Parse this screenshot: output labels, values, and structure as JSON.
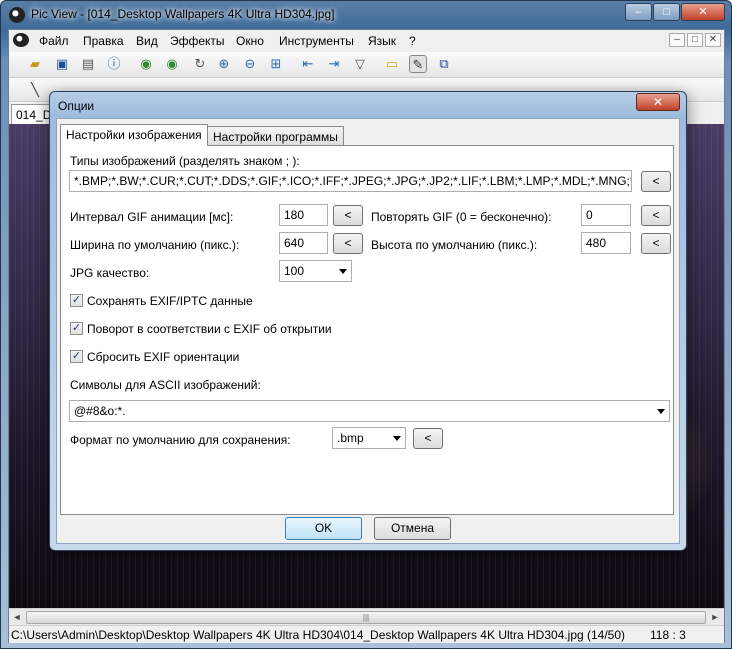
{
  "window": {
    "title": "Pic View - [014_Desktop Wallpapers 4K Ultra HD304.jpg]",
    "minimize": "–",
    "maximize": "□",
    "close": "✕"
  },
  "menu": {
    "items": [
      "Файл",
      "Правка",
      "Вид",
      "Эффекты",
      "Окно",
      "Инструменты",
      "Язык",
      "?"
    ],
    "mdi_minimize": "–",
    "mdi_restore": "□",
    "mdi_close": "✕"
  },
  "doc_tab": "014_D",
  "statusbar": {
    "path": "C:\\Users\\Admin\\Desktop\\Desktop Wallpapers 4K Ultra HD304\\014_Desktop Wallpapers 4K Ultra HD304.jpg",
    "count": "(14/50)",
    "coords": "118 : 3"
  },
  "scroll": {
    "thumb": "|||",
    "left_arrow": "◄",
    "right_arrow": "►"
  },
  "dialog": {
    "title": "Опции",
    "close": "✕",
    "tabs": [
      "Настройки изображения",
      "Настройки программы"
    ],
    "image_types_label": "Типы изображений (разделять знаком ; ):",
    "image_types_value": "*.BMP;*.BW;*.CUR;*.CUT;*.DDS;*.GIF;*.ICO;*.IFF;*.JPEG;*.JPG;*.JP2;*.LIF;*.LBM;*.LMP;*.MDL;*.MNG;*.PCX;*.",
    "gif_interval_label": "Интервал GIF анимации [мс]:",
    "gif_interval_value": "180",
    "gif_repeat_label": "Повторять GIF (0 = бесконечно):",
    "gif_repeat_value": "0",
    "width_label": "Ширина по умолчанию (пикс.):",
    "width_value": "640",
    "height_label": "Высота по умолчанию (пикс.):",
    "height_value": "480",
    "jpg_label": "JPG качество:",
    "jpg_value": "100",
    "chk_exif_label": "Сохранять EXIF/IPTC данные",
    "chk_rotate_label": "Поворот в соответствии с EXIF об открытии",
    "chk_reset_label": "Сбросить EXIF ориентации",
    "ascii_label": "Символы для ASCII изображений:",
    "ascii_value": "@#8&o:*.",
    "save_format_label": "Формат по умолчанию для сохранения:",
    "save_format_value": ".bmp",
    "reset_btn": "<",
    "check_mark": "✓",
    "ok": "OK",
    "cancel": "Отмена"
  },
  "colors": {
    "accent": "#3c7fb1",
    "title_gradient": "#9fbbdc"
  }
}
